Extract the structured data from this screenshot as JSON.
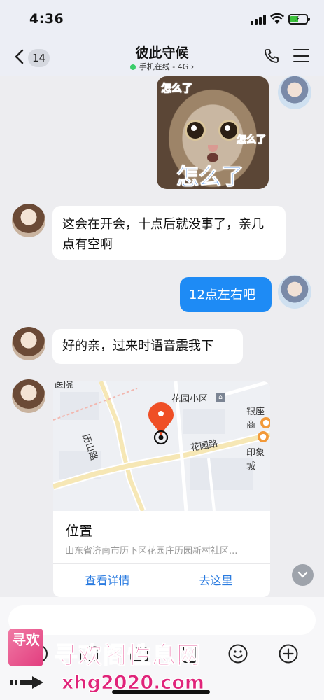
{
  "status_bar": {
    "time": "4:36"
  },
  "header": {
    "back_count": "14",
    "title": "彼此守候",
    "subtitle": "手机在线 - 4G",
    "online_color": "#3bcd6a"
  },
  "messages": {
    "sticker": {
      "captions": [
        "怎么了",
        "怎么了",
        "怎么了"
      ]
    },
    "m1": "这会在开会，十点后就没事了，亲几点有空啊",
    "m2": "12点左右吧",
    "m3": "好的亲，过来时语音震我下",
    "location": {
      "map_labels": {
        "top_left": "医院",
        "huayuan_xiaoqu": "花园小区",
        "yinzuo": "银座商",
        "lishan_road": "历山路",
        "huayuan_road": "花园路",
        "yinxiang": "印象城"
      },
      "title": "位置",
      "address": "山东省济南市历下区花园庄历园新村社区...",
      "view_details": "查看详情",
      "go_here": "去这里"
    }
  },
  "accent_color": "#1e8bf5",
  "watermark": {
    "logo_text": "寻欢",
    "site_name": "寻欢阁性息网",
    "url": "xhg2020.com"
  }
}
